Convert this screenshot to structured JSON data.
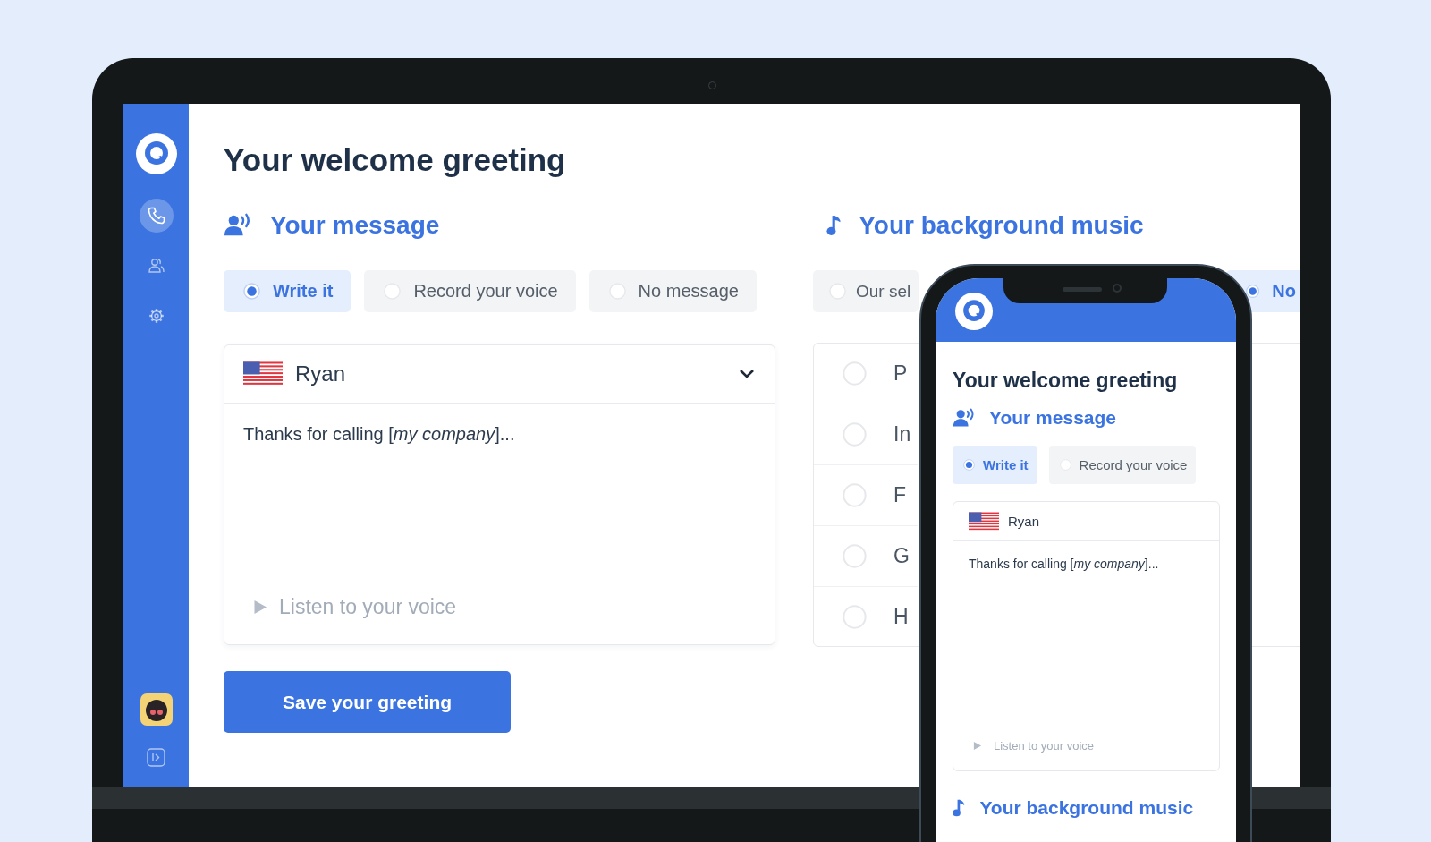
{
  "laptop": {
    "sidebar": [
      {
        "kind": "calls",
        "selected": true
      },
      {
        "kind": "contacts",
        "selected": false
      },
      {
        "kind": "settings",
        "selected": false
      }
    ],
    "title": "Your welcome greeting",
    "message": {
      "heading": "Your message",
      "options": [
        {
          "label": "Write it",
          "selected": true
        },
        {
          "label": "Record your voice",
          "selected": false
        },
        {
          "label": "No message",
          "selected": false
        }
      ],
      "voice": "Ryan",
      "text": "Thanks for calling [*my company*]...",
      "listen": "Listen to your voice"
    },
    "music": {
      "heading": "Your background music",
      "options": [
        {
          "label": "Our sel",
          "selected": false
        },
        {
          "label": "No",
          "selected": true
        }
      ],
      "tracks": [
        {
          "label": "P",
          "selected": false
        },
        {
          "label": "In",
          "selected": false
        },
        {
          "label": "F",
          "selected": false
        },
        {
          "label": "G",
          "selected": false
        },
        {
          "label": "H",
          "selected": false
        }
      ]
    },
    "save_button": "Save your greeting"
  },
  "phone": {
    "title": "Your welcome greeting",
    "message": {
      "heading": "Your message",
      "options": [
        {
          "label": "Write it",
          "selected": true
        },
        {
          "label": "Record your voice",
          "selected": false
        }
      ],
      "voice": "Ryan",
      "text": "Thanks for calling [*my company*]...",
      "listen": "Listen to your voice"
    },
    "music_heading": "Your background music"
  }
}
